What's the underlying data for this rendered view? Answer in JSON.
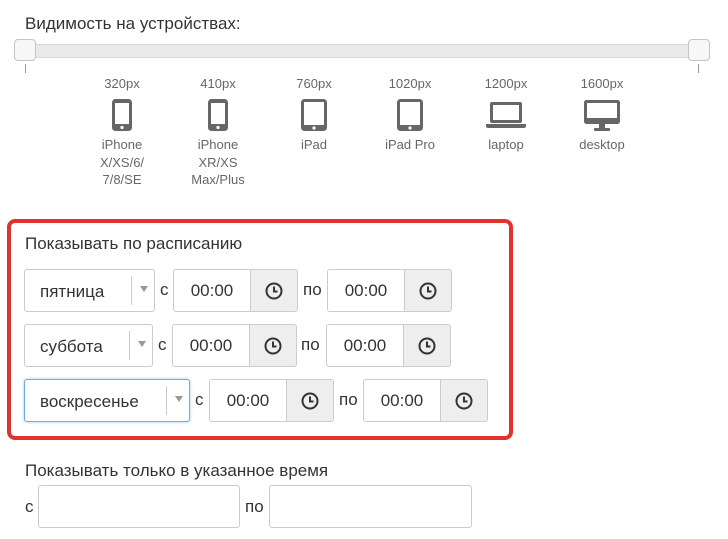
{
  "visibility": {
    "title": "Видимость на устройствах:",
    "devices": [
      {
        "px": "320px",
        "name": [
          "iPhone",
          "X/XS/6/",
          "7/8/SE"
        ],
        "icon": "phone-icon"
      },
      {
        "px": "410px",
        "name": [
          "iPhone",
          "XR/XS",
          "Max/Plus"
        ],
        "icon": "phone-icon"
      },
      {
        "px": "760px",
        "name": [
          "iPad"
        ],
        "icon": "tablet-icon"
      },
      {
        "px": "1020px",
        "name": [
          "iPad Pro"
        ],
        "icon": "tablet-icon"
      },
      {
        "px": "1200px",
        "name": [
          "laptop"
        ],
        "icon": "laptop-icon"
      },
      {
        "px": "1600px",
        "name": [
          "desktop"
        ],
        "icon": "desktop-icon"
      }
    ]
  },
  "schedule": {
    "title": "Показывать по расписанию",
    "from_label": "с",
    "to_label": "по",
    "rows": [
      {
        "day": "пятница",
        "from": "00:00",
        "to": "00:00"
      },
      {
        "day": "суббота",
        "from": "00:00",
        "to": "00:00"
      },
      {
        "day": "воскресенье",
        "from": "00:00",
        "to": "00:00"
      }
    ]
  },
  "only_time": {
    "title": "Показывать только в указанное время",
    "from_label": "с",
    "to_label": "по",
    "from_value": "",
    "to_value": ""
  },
  "colors": {
    "highlight_border": "#e0332d",
    "icon_gray": "#666666",
    "focus_blue": "#66afe9"
  }
}
